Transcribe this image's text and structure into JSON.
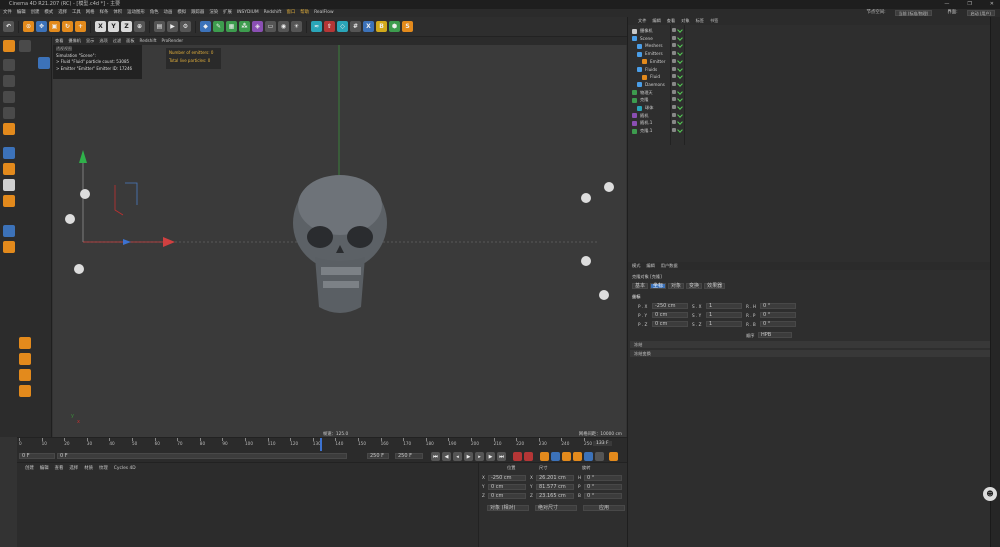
{
  "window": {
    "title": "Cinema 4D R21.207 (RC) - [模型.c4d *] - 主要",
    "controls": [
      "—",
      "❐",
      "✕"
    ]
  },
  "menubar": {
    "items": [
      "文件",
      "编辑",
      "创建",
      "模式",
      "选择",
      "工具",
      "网格",
      "样条",
      "体积",
      "运动图形",
      "角色",
      "动画",
      "模拟",
      "跟踪器",
      "渲染",
      "扩展",
      "INSYDIUM",
      "Redshift",
      "窗口",
      "帮助",
      "RealFlow"
    ],
    "node_space_label": "节点空间:",
    "node_space_value": "当前 (标准/物理)",
    "layout_label": "界面:",
    "layout_value": "启动 (用户)"
  },
  "toolbar": {
    "icons": [
      "undo-icon",
      "live-select-icon",
      "move-icon",
      "scale-icon",
      "rotate-icon",
      "last-tool-icon",
      "x-axis-icon",
      "y-axis-icon",
      "z-axis-icon",
      "coord-system-icon",
      "render-view-icon",
      "render-active-icon",
      "render-settings-icon",
      "cube-icon",
      "pen-icon",
      "subdivision-icon",
      "cloner-icon",
      "deformer-icon",
      "floor-icon",
      "camera-icon",
      "light-icon",
      "realflow-icon",
      "emitter-icon",
      "domain-icon",
      "grid-icon",
      "xp-icon",
      "b-icon",
      "redshift-icon",
      "s-icon"
    ],
    "axis_labels": [
      "X",
      "Y",
      "Z"
    ]
  },
  "viewport": {
    "menu": [
      "查看",
      "摄像机",
      "显示",
      "选项",
      "过滤",
      "面板",
      "Redshift",
      "ProRender"
    ],
    "label": "透视视图",
    "simulation": {
      "title": "Simulation \"Scene\":",
      "lines": [
        "> Fluid \"Fluid\" particle count: 53085",
        "> Emitter \"Emitter\" Emitter ID: 17246"
      ]
    },
    "info": [
      "Number of emitters: 0",
      "Total live particles: 0"
    ],
    "fps": "帧速：125.0",
    "grid": "网格间距：10000 cm"
  },
  "timeline": {
    "ticks": [
      "0",
      "10",
      "20",
      "30",
      "40",
      "50",
      "60",
      "70",
      "80",
      "90",
      "100",
      "110",
      "120",
      "130",
      "140",
      "150",
      "160",
      "170",
      "180",
      "190",
      "200",
      "210",
      "220",
      "230",
      "240",
      "250"
    ],
    "current": "133 F",
    "start": "0 F",
    "start2": "0 F",
    "end": "250 F",
    "end2": "250 F"
  },
  "bottom_tabs": [
    "创建",
    "编辑",
    "查看",
    "选择",
    "材质",
    "纹理",
    "Cycles 4D"
  ],
  "coords": {
    "headers": [
      "位置",
      "尺寸",
      "旋转"
    ],
    "rows": [
      {
        "axis": "X",
        "pos": "-250 cm",
        "size_axis": "X",
        "size": "26.201 cm",
        "rot_axis": "H",
        "rot": "0 °"
      },
      {
        "axis": "Y",
        "pos": "0 cm",
        "size_axis": "Y",
        "size": "81.577 cm",
        "rot_axis": "P",
        "rot": "0 °"
      },
      {
        "axis": "Z",
        "pos": "0 cm",
        "size_axis": "Z",
        "size": "23.165 cm",
        "rot_axis": "B",
        "rot": "0 °"
      }
    ],
    "mode1": "对象 (相对)",
    "mode2": "绝对尺寸",
    "apply": "应用"
  },
  "object_manager": {
    "menu": [
      "文件",
      "编辑",
      "查看",
      "对象",
      "标签",
      "书签"
    ],
    "objects": [
      {
        "name": "摄像机",
        "indent": 1,
        "color": "#c8c8c8"
      },
      {
        "name": "Scene",
        "indent": 1,
        "color": "#4a9ee8"
      },
      {
        "name": "Meshers",
        "indent": 2,
        "color": "#4a9ee8"
      },
      {
        "name": "Emitters",
        "indent": 2,
        "color": "#4a9ee8"
      },
      {
        "name": "Emitter",
        "indent": 3,
        "color": "#e38a1c"
      },
      {
        "name": "Fluids",
        "indent": 2,
        "color": "#4a9ee8"
      },
      {
        "name": "Fluid",
        "indent": 3,
        "color": "#e38a1c"
      },
      {
        "name": "Daemons",
        "indent": 2,
        "color": "#4a9ee8"
      },
      {
        "name": "物理天",
        "indent": 1,
        "color": "#3d9c4e"
      },
      {
        "name": "克隆",
        "indent": 1,
        "color": "#3d9c4e"
      },
      {
        "name": "球体",
        "indent": 2,
        "color": "#2aa5b8"
      },
      {
        "name": "随机",
        "indent": 1,
        "color": "#8a4fb3"
      },
      {
        "name": "随机.1",
        "indent": 1,
        "color": "#8a4fb3"
      },
      {
        "name": "克隆.1",
        "indent": 1,
        "color": "#3d9c4e"
      }
    ]
  },
  "attributes": {
    "menu": [
      "模式",
      "编辑",
      "用户数据"
    ],
    "object_title": "克隆对象 [克隆]",
    "tabs": [
      "基本",
      "坐标",
      "对象",
      "变换",
      "效果器"
    ],
    "section": "坐标",
    "rows": [
      {
        "p": "P . X",
        "pv": "-250 cm",
        "s": "S . X",
        "sv": "1",
        "r": "R . H",
        "rv": "0 °"
      },
      {
        "p": "P . Y",
        "pv": "0 cm",
        "s": "S . Y",
        "sv": "1",
        "r": "R . P",
        "rv": "0 °"
      },
      {
        "p": "P . Z",
        "pv": "0 cm",
        "s": "S . Z",
        "sv": "1",
        "r": "R . B",
        "rv": "0 °"
      }
    ],
    "order_label": "顺序",
    "order_value": "HPB",
    "freeze": "冻结",
    "freeze2": "冻结变换"
  }
}
